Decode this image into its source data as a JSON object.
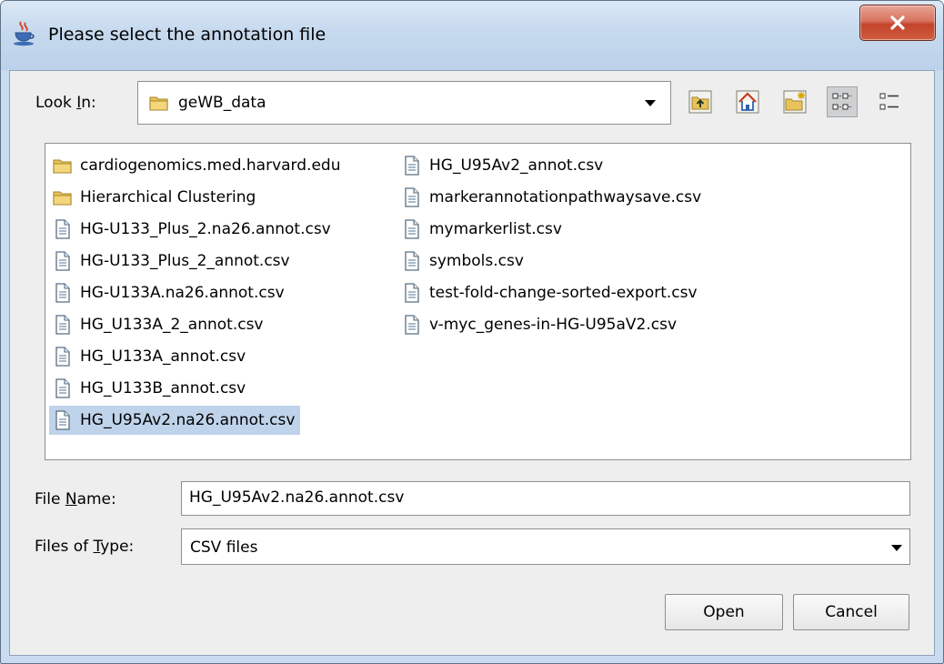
{
  "dialog": {
    "title": "Please select the annotation file",
    "close_label": "X"
  },
  "look_in": {
    "label": "Look In:",
    "mnemonic_pre": "Look ",
    "mnemonic_char": "I",
    "mnemonic_post": "n:",
    "value": "geWB_data"
  },
  "toolbar": {
    "up_folder": "folder-up-icon",
    "home": "home-icon",
    "new_folder": "new-folder-icon",
    "list_view": "list-view-icon",
    "details_view": "details-view-icon"
  },
  "files": {
    "column1": [
      {
        "name": "cardiogenomics.med.harvard.edu",
        "type": "folder"
      },
      {
        "name": "Hierarchical Clustering",
        "type": "folder"
      },
      {
        "name": "HG-U133_Plus_2.na26.annot.csv",
        "type": "file"
      },
      {
        "name": "HG-U133_Plus_2_annot.csv",
        "type": "file"
      },
      {
        "name": "HG-U133A.na26.annot.csv",
        "type": "file"
      },
      {
        "name": "HG_U133A_2_annot.csv",
        "type": "file"
      },
      {
        "name": "HG_U133A_annot.csv",
        "type": "file"
      },
      {
        "name": "HG_U133B_annot.csv",
        "type": "file"
      },
      {
        "name": "HG_U95Av2.na26.annot.csv",
        "type": "file",
        "selected": true
      }
    ],
    "column2": [
      {
        "name": "HG_U95Av2_annot.csv",
        "type": "file"
      },
      {
        "name": "markerannotationpathwaysave.csv",
        "type": "file"
      },
      {
        "name": "mymarkerlist.csv",
        "type": "file"
      },
      {
        "name": "symbols.csv",
        "type": "file"
      },
      {
        "name": "test-fold-change-sorted-export.csv",
        "type": "file"
      },
      {
        "name": "v-myc_genes-in-HG-U95aV2.csv",
        "type": "file"
      }
    ]
  },
  "file_name": {
    "pre": "File ",
    "mnemonic": "N",
    "post": "ame:",
    "value": "HG_U95Av2.na26.annot.csv"
  },
  "file_type": {
    "pre": "Files of ",
    "mnemonic": "T",
    "post": "ype:",
    "value": "CSV files"
  },
  "buttons": {
    "open": "Open",
    "cancel": "Cancel"
  },
  "colors": {
    "selection": "#bfd3ea",
    "folder": "#e8c25a",
    "window_frame": "#c9dcef"
  }
}
